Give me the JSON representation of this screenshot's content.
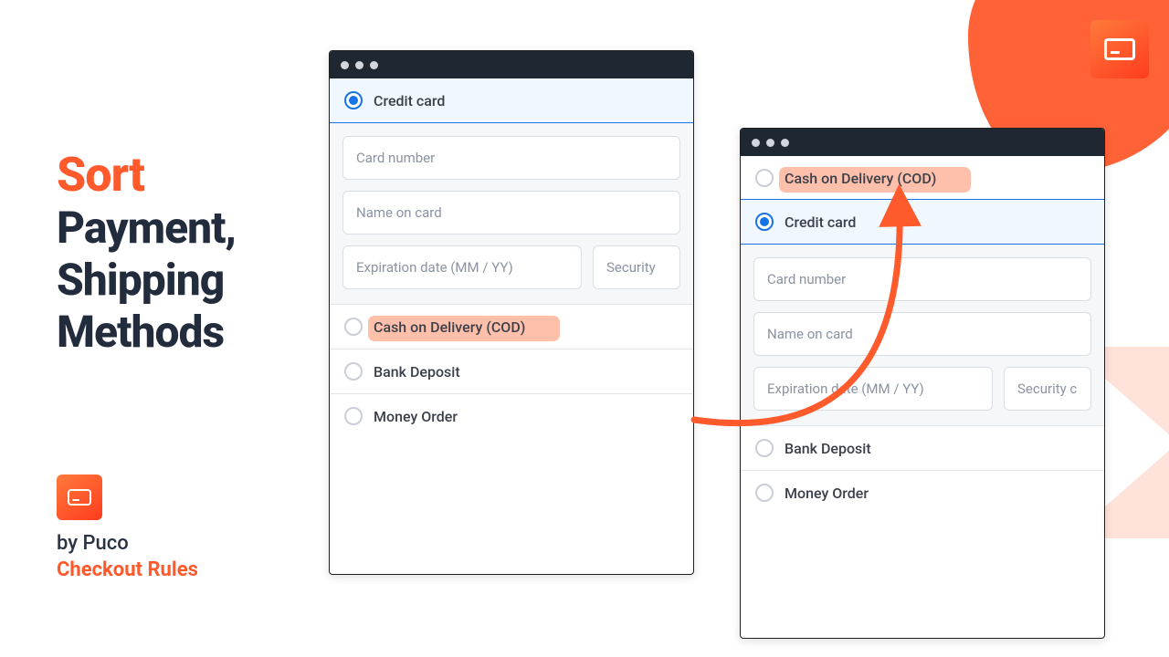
{
  "headline": {
    "accent": "Sort",
    "line2": "Payment,",
    "line3": "Shipping",
    "line4": "Methods"
  },
  "byline": {
    "prefix": "by Puco",
    "brand": "Checkout Rules"
  },
  "options": {
    "credit_card": "Credit card",
    "cod": "Cash on Delivery (COD)",
    "bank_deposit": "Bank Deposit",
    "money_order": "Money Order"
  },
  "fields": {
    "card_number": "Card number",
    "name_on_card": "Name on card",
    "exp": "Expiration date (MM / YY)",
    "sec_a": "Security",
    "sec_b": "Security c"
  },
  "colors": {
    "accent": "#ff5a2c",
    "radio_active": "#1773e6",
    "highlight": "#ffb59c"
  }
}
